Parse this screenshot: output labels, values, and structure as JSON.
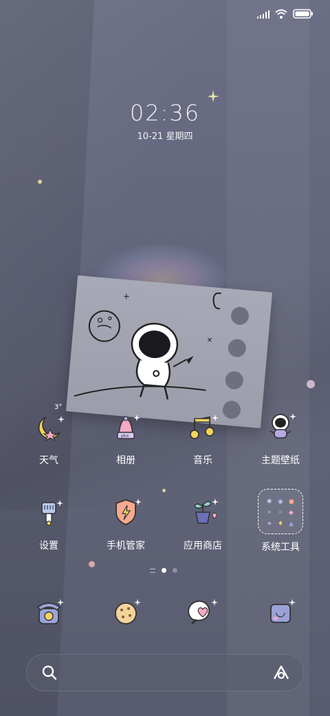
{
  "status_bar": {
    "signal_icon": "cellular-signal-icon",
    "wifi_icon": "wifi-icon",
    "battery_icon": "battery-icon"
  },
  "clock": {
    "time": "02:36",
    "date": "10-21 星期四"
  },
  "apps_row1": [
    {
      "label": "天气",
      "icon": "moon-weather-icon",
      "badge": "3°"
    },
    {
      "label": "相册",
      "icon": "photo-book-icon",
      "badge_text": "pho"
    },
    {
      "label": "音乐",
      "icon": "music-note-icon"
    },
    {
      "label": "主题壁纸",
      "icon": "astronaut-icon"
    }
  ],
  "apps_row2": [
    {
      "label": "设置",
      "icon": "settings-bulb-icon"
    },
    {
      "label": "手机管家",
      "icon": "shield-bolt-icon"
    },
    {
      "label": "应用商店",
      "icon": "plant-pot-icon"
    },
    {
      "label": "系统工具",
      "icon": "folder-icon"
    }
  ],
  "page_indicator": {
    "pages": 3,
    "active": 2
  },
  "dock": [
    {
      "icon": "phone-icon"
    },
    {
      "icon": "cookie-contacts-icon"
    },
    {
      "icon": "heart-message-icon"
    },
    {
      "icon": "camera-icon"
    }
  ],
  "search_bar": {
    "search_icon": "search-icon",
    "assistant_icon": "assistant-a-icon"
  },
  "colors": {
    "background": "#62657b",
    "card": "#a3a4b1",
    "accent_yellow": "#f4d35e",
    "accent_pink": "#f5a9c4",
    "accent_purple": "#b7a8e3"
  }
}
